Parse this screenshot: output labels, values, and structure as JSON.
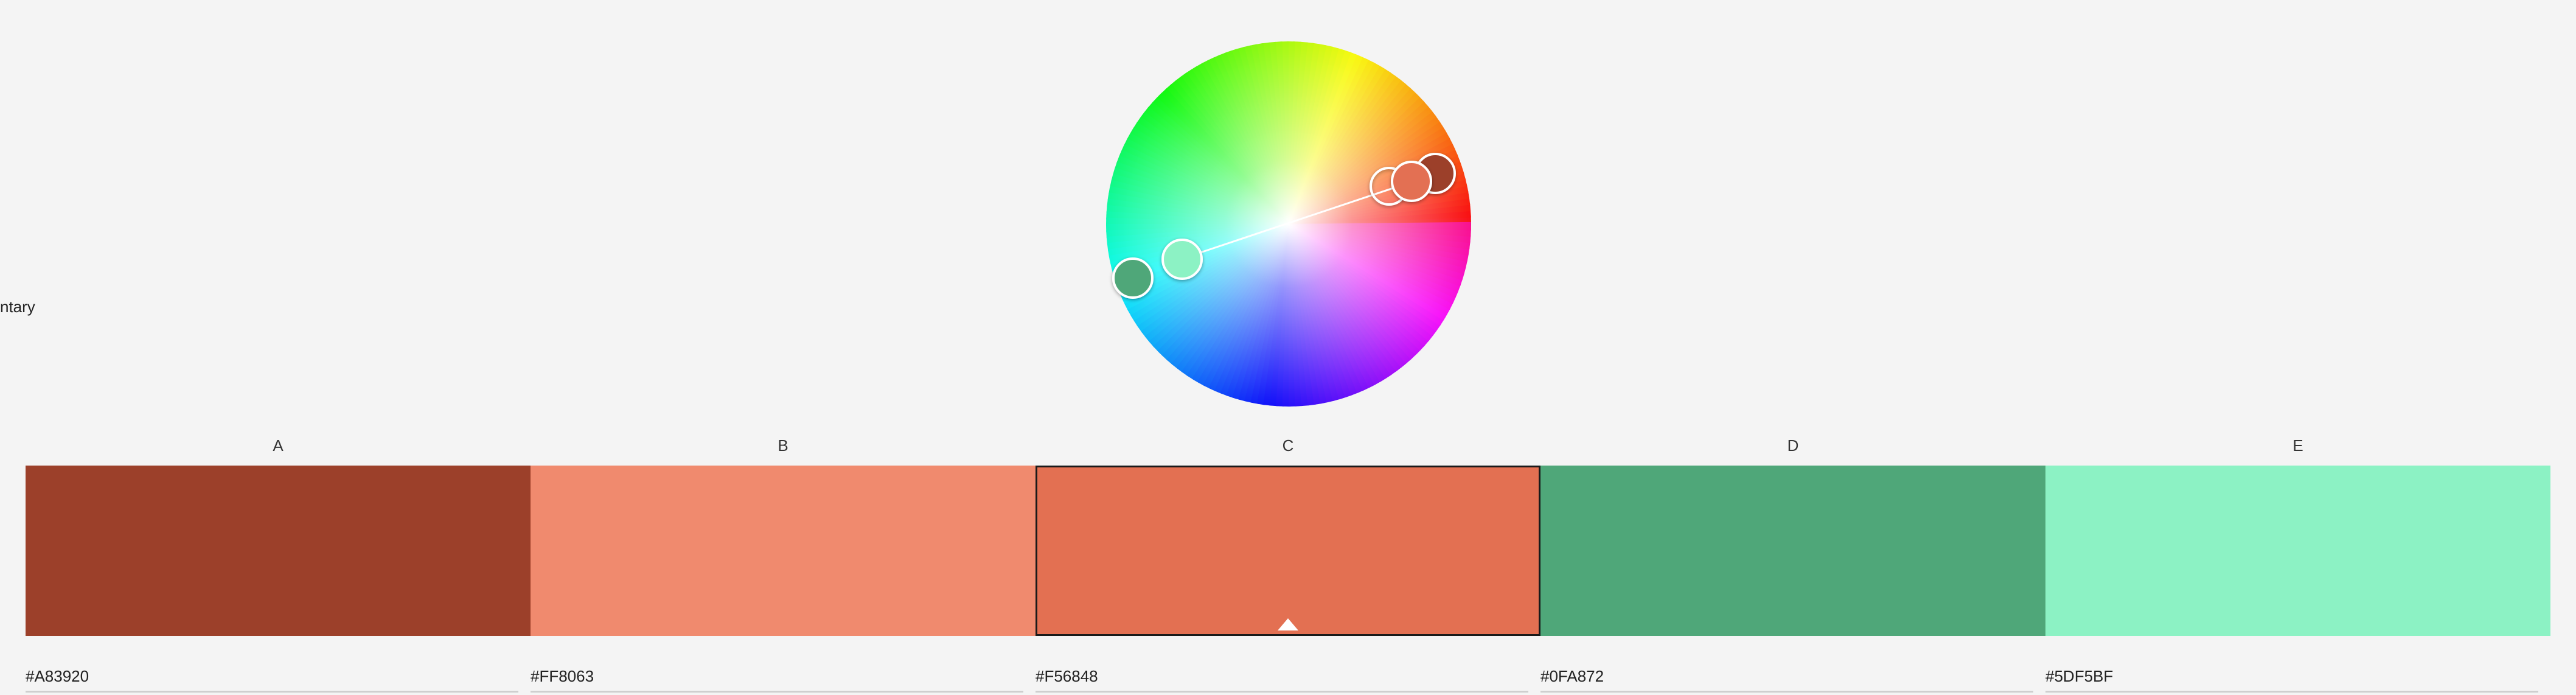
{
  "harmony_rule_label": "ntary",
  "swatches": [
    {
      "label": "A",
      "hex": "#A83920",
      "color": "#9c402a"
    },
    {
      "label": "B",
      "hex": "#FF8063",
      "color": "#f08a6e"
    },
    {
      "label": "C",
      "hex": "#F56848",
      "color": "#e37052",
      "selected": true
    },
    {
      "label": "D",
      "hex": "#0FA872",
      "color": "#4fa779"
    },
    {
      "label": "E",
      "hex": "#5DF5BF",
      "color": "#8cf2c4"
    }
  ]
}
